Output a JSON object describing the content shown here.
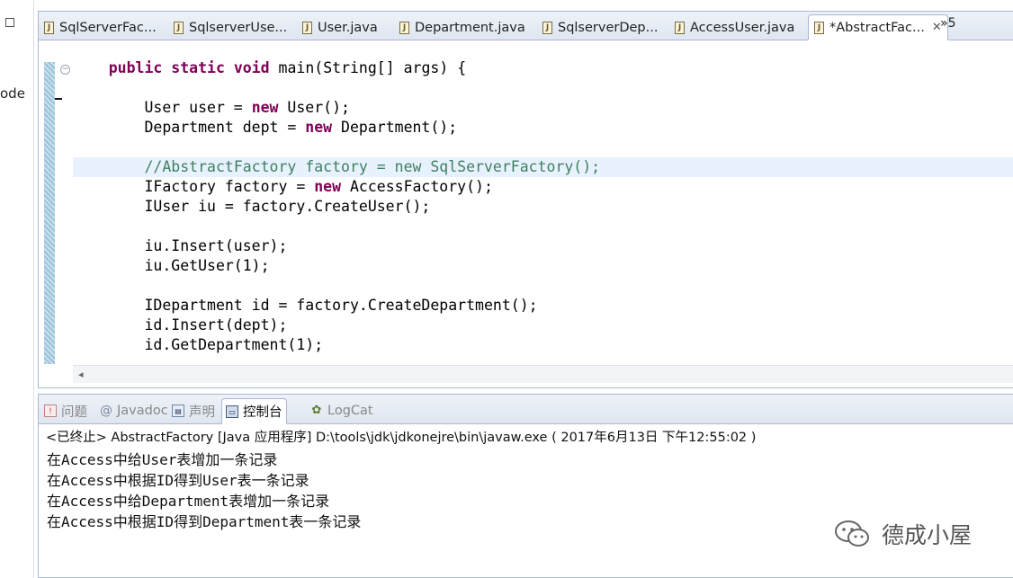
{
  "left_panel": {
    "label": "ode"
  },
  "editor": {
    "tabs": [
      {
        "label": "SqlServerFac...",
        "icon": "java-file-icon"
      },
      {
        "label": "SqlserverUse...",
        "icon": "java-file-icon"
      },
      {
        "label": "User.java",
        "icon": "java-file-icon"
      },
      {
        "label": "Department.java",
        "icon": "java-file-icon"
      },
      {
        "label": "SqlserverDep...",
        "icon": "java-file-icon"
      },
      {
        "label": "AccessUser.java",
        "icon": "java-file-icon"
      },
      {
        "label": "*AbstractFac...",
        "icon": "java-file-icon",
        "active": true
      }
    ],
    "overflow_label": "»5",
    "code_lines": [
      "    public static void main(String[] args) {",
      "",
      "        User user = new User();",
      "        Department dept = new Department();",
      "",
      "        //AbstractFactory factory = new SqlServerFactory();",
      "        IFactory factory = new AccessFactory();",
      "        IUser iu = factory.CreateUser();",
      "",
      "        iu.Insert(user);",
      "        iu.GetUser(1);",
      "",
      "        IDepartment id = factory.CreateDepartment();",
      "        id.Insert(dept);",
      "        id.GetDepartment(1);"
    ]
  },
  "console": {
    "tabs": [
      {
        "label": "问题",
        "icon": "problems-icon"
      },
      {
        "label": "Javadoc",
        "icon": "at-icon"
      },
      {
        "label": "声明",
        "icon": "declaration-icon"
      },
      {
        "label": "控制台",
        "icon": "console-icon",
        "active": true
      },
      {
        "label": "LogCat",
        "icon": "logcat-icon"
      }
    ],
    "header": "<已终止> AbstractFactory [Java 应用程序] D:\\tools\\jdk\\jdkonejre\\bin\\javaw.exe ( 2017年6月13日 下午12:55:02 )",
    "output_lines": [
      "在Access中给User表增加一条记录",
      "在Access中根据ID得到User表一条记录",
      "在Access中给Department表增加一条记录",
      "在Access中根据ID得到Department表一条记录"
    ]
  },
  "watermark": {
    "text": "德成小屋"
  }
}
